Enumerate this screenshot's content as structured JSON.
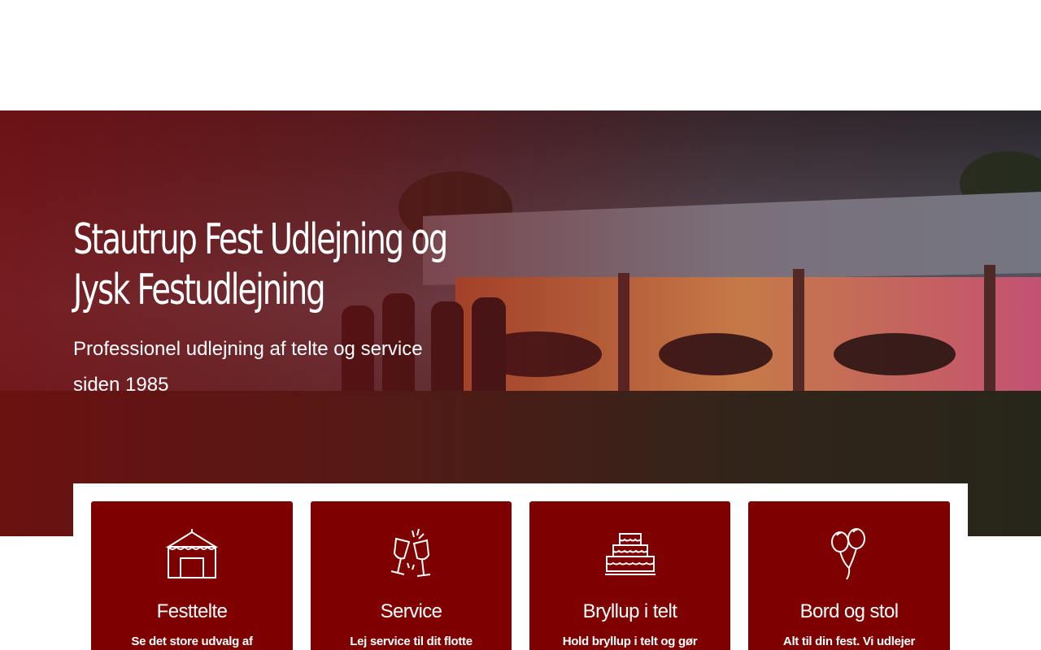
{
  "hero": {
    "title_line1": "Stautrup Fest Udlejning og",
    "title_line2": "Jysk Festudlejning",
    "subtitle_line1": "Professionel udlejning af telte og service",
    "subtitle_line2": "siden 1985"
  },
  "cards": [
    {
      "icon": "tent-icon",
      "title": "Festtelte",
      "text": "Se det store udvalg af"
    },
    {
      "icon": "champagne-glasses-icon",
      "title": "Service",
      "text": "Lej service til dit flotte"
    },
    {
      "icon": "wedding-cake-icon",
      "title": "Bryllup i telt",
      "text": "Hold bryllup i telt og gør"
    },
    {
      "icon": "balloons-icon",
      "title": "Bord og stol",
      "text": "Alt til din fest. Vi udlejer"
    }
  ],
  "colors": {
    "card_bg": "#7f0000",
    "overlay": "#780c0e",
    "text": "#ffffff"
  }
}
